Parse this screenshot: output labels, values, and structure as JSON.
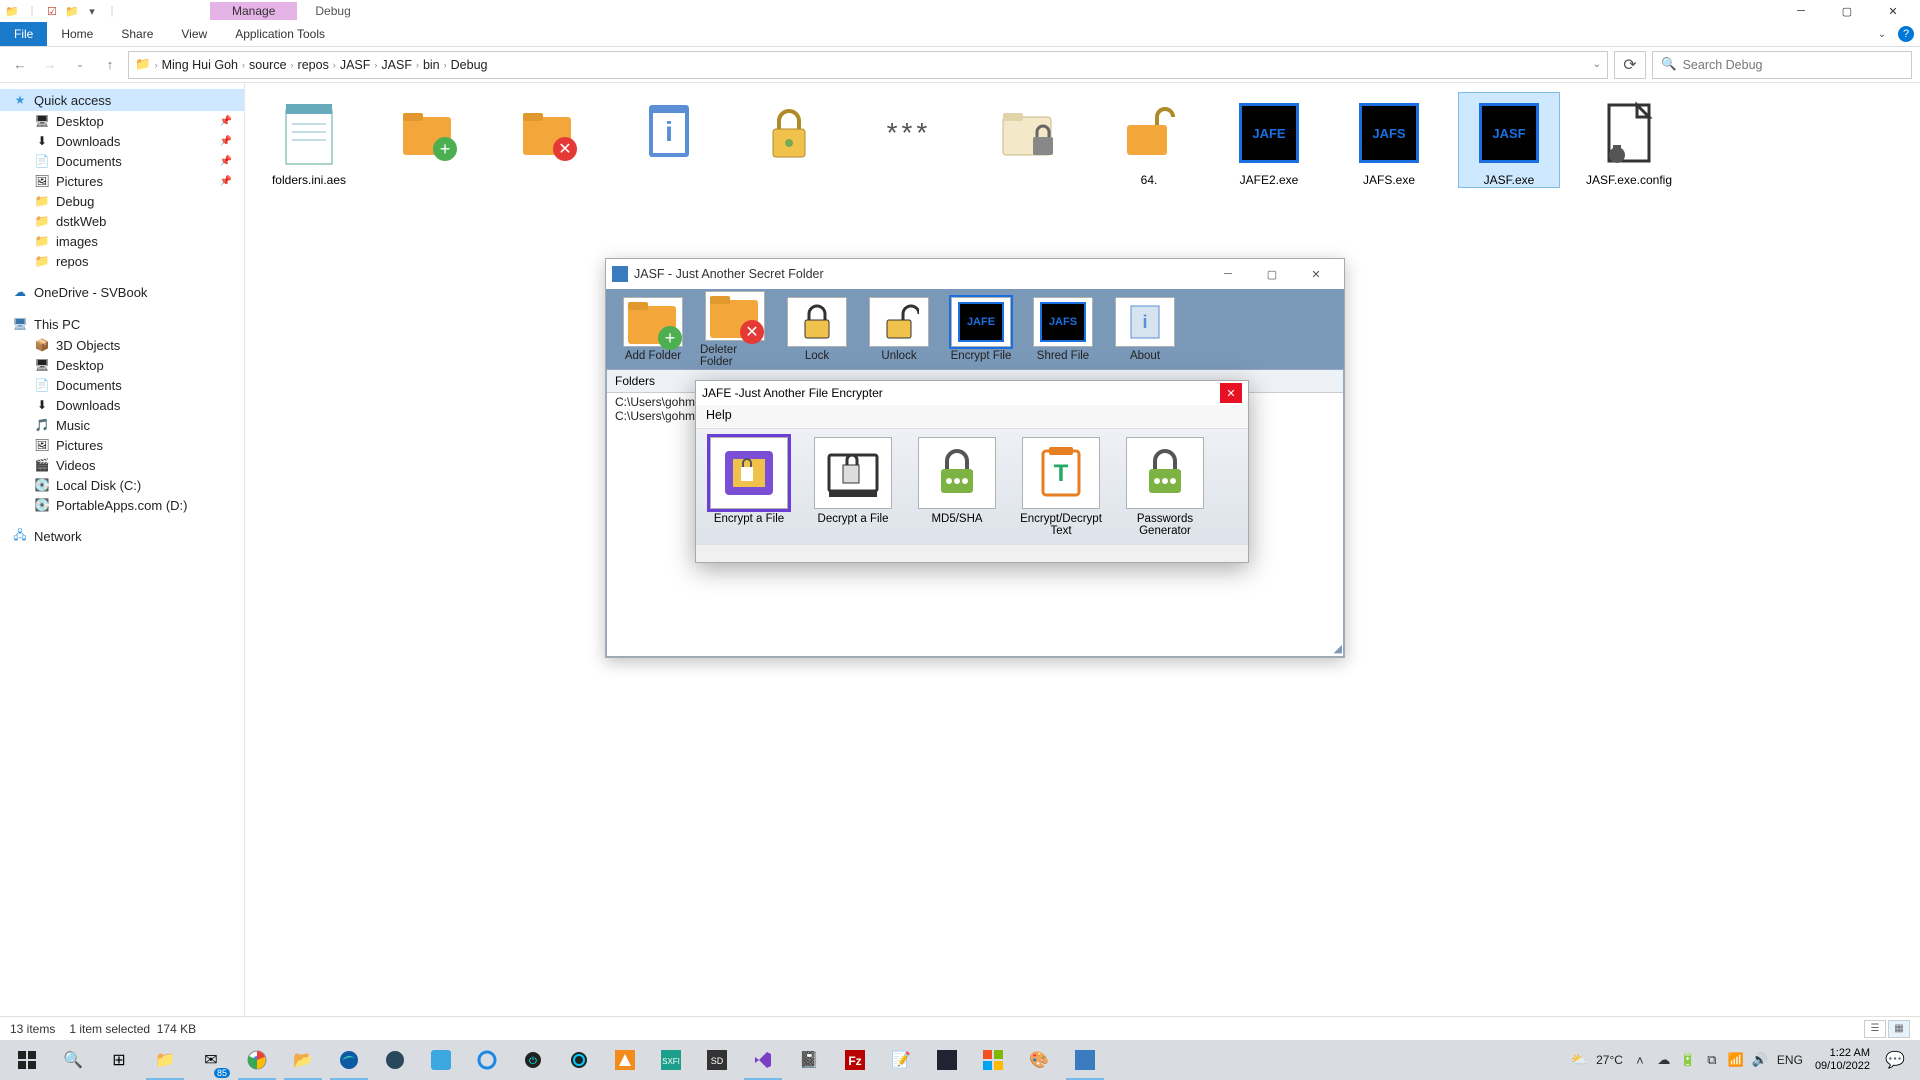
{
  "titlebar": {
    "context_tab": "Manage",
    "location_tab": "Debug"
  },
  "ribbon": {
    "file": "File",
    "home": "Home",
    "share": "Share",
    "view": "View",
    "app_tools": "Application Tools"
  },
  "breadcrumbs": [
    "Ming Hui Goh",
    "source",
    "repos",
    "JASF",
    "JASF",
    "bin",
    "Debug"
  ],
  "search": {
    "placeholder": "Search Debug"
  },
  "sidebar": {
    "quick_access": "Quick access",
    "quick_items": [
      {
        "label": "Desktop",
        "pinned": true,
        "icon": "desktop"
      },
      {
        "label": "Downloads",
        "pinned": true,
        "icon": "download"
      },
      {
        "label": "Documents",
        "pinned": true,
        "icon": "doc"
      },
      {
        "label": "Pictures",
        "pinned": true,
        "icon": "pic"
      },
      {
        "label": "Debug",
        "pinned": false,
        "icon": "folder"
      },
      {
        "label": "dstkWeb",
        "pinned": false,
        "icon": "folder"
      },
      {
        "label": "images",
        "pinned": false,
        "icon": "folder"
      },
      {
        "label": "repos",
        "pinned": false,
        "icon": "folder"
      }
    ],
    "onedrive": "OneDrive - SVBook",
    "this_pc": "This PC",
    "pc_items": [
      {
        "label": "3D Objects",
        "icon": "cube"
      },
      {
        "label": "Desktop",
        "icon": "desktop"
      },
      {
        "label": "Documents",
        "icon": "doc"
      },
      {
        "label": "Downloads",
        "icon": "download"
      },
      {
        "label": "Music",
        "icon": "music"
      },
      {
        "label": "Pictures",
        "icon": "pic"
      },
      {
        "label": "Videos",
        "icon": "video"
      },
      {
        "label": "Local Disk (C:)",
        "icon": "drive"
      },
      {
        "label": "PortableApps.com (D:)",
        "icon": "drive"
      }
    ],
    "network": "Network"
  },
  "files": {
    "items": [
      {
        "name": "folders.ini.aes",
        "icon": "notepad"
      },
      {
        "name": "",
        "icon": "folder-add"
      },
      {
        "name": "",
        "icon": "folder-del"
      },
      {
        "name": "",
        "icon": "info"
      },
      {
        "name": "",
        "icon": "lock"
      },
      {
        "name": "",
        "icon": "stars"
      },
      {
        "name": "",
        "icon": "folder-lock"
      },
      {
        "name": "64.",
        "icon": "unlock-folder"
      },
      {
        "name": "JAFE2.exe",
        "icon": "jafe"
      },
      {
        "name": "JAFS.exe",
        "icon": "jafs"
      },
      {
        "name": "JASF.exe",
        "icon": "jasf",
        "selected": true
      },
      {
        "name": "JASF.exe.config",
        "icon": "config"
      }
    ]
  },
  "jasf": {
    "title": "JASF - Just Another Secret Folder",
    "tools": [
      {
        "label": "Add Folder"
      },
      {
        "label": "Deleter Folder"
      },
      {
        "label": "Lock"
      },
      {
        "label": "Unlock"
      },
      {
        "label": "Encrypt File",
        "selected": true
      },
      {
        "label": "Shred File"
      },
      {
        "label": "About"
      }
    ],
    "folders_header": "Folders",
    "folder_paths": [
      "C:\\Users\\gohmi\\D",
      "C:\\Users\\gohmi\\D"
    ]
  },
  "jafe": {
    "title": "JAFE -Just Another File Encrypter",
    "menu_help": "Help",
    "tools": [
      {
        "label": "Encrypt a File",
        "selected": true
      },
      {
        "label": "Decrypt a File"
      },
      {
        "label": "MD5/SHA"
      },
      {
        "label": "Encrypt/Decrypt Text"
      },
      {
        "label": "Passwords Generator"
      }
    ]
  },
  "statusbar": {
    "items": "13 items",
    "selection": "1 item selected",
    "size": "174 KB"
  },
  "taskbar": {
    "weather": "27°C",
    "lang": "ENG",
    "time": "1:22 AM",
    "date": "09/10/2022",
    "mail_badge": "85"
  }
}
